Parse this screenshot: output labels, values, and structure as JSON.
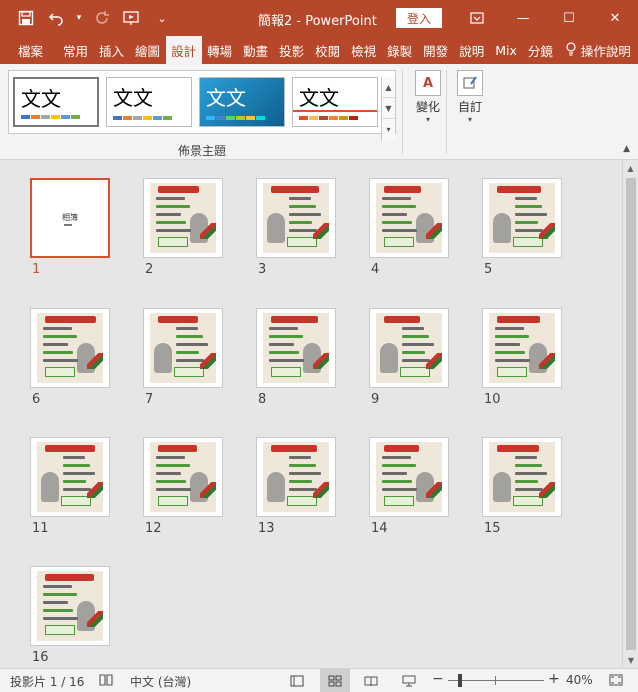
{
  "title_bar": {
    "doc_title": "簡報2 - PowerPoint",
    "sign_in": "登入",
    "qat": [
      {
        "name": "save-icon",
        "glyph": "💾"
      },
      {
        "name": "undo-icon",
        "glyph": "↶"
      },
      {
        "name": "undo-dropdown-icon",
        "glyph": "▾"
      },
      {
        "name": "redo-icon",
        "glyph": "↻"
      },
      {
        "name": "present-from-start-icon",
        "glyph": "▣"
      },
      {
        "name": "customize-qat-icon",
        "glyph": "⌄"
      }
    ],
    "window_buttons": {
      "ribbon_options": "▭",
      "minimize": "—",
      "restore": "☐",
      "close": "✕"
    }
  },
  "tabs": [
    {
      "label": "檔案",
      "active": false
    },
    {
      "label": "常用",
      "active": false
    },
    {
      "label": "插入",
      "active": false
    },
    {
      "label": "繪圖",
      "active": false
    },
    {
      "label": "設計",
      "active": true
    },
    {
      "label": "轉場",
      "active": false
    },
    {
      "label": "動畫",
      "active": false
    },
    {
      "label": "投影",
      "active": false
    },
    {
      "label": "校閱",
      "active": false
    },
    {
      "label": "檢視",
      "active": false
    },
    {
      "label": "錄製",
      "active": false
    },
    {
      "label": "開發",
      "active": false
    },
    {
      "label": "說明",
      "active": false
    },
    {
      "label": "Mix",
      "active": false
    },
    {
      "label": "分鏡",
      "active": false
    }
  ],
  "tell_me": {
    "label": "操作說明",
    "icon": "lightbulb-icon"
  },
  "ribbon": {
    "themes": [
      {
        "text": "文文",
        "bg": "#ffffff",
        "color": "#222222",
        "swatches": [
          "#4472c4",
          "#ed7d31",
          "#a5a5a5",
          "#ffc000",
          "#5b9bd5",
          "#70ad47"
        ]
      },
      {
        "text": "文文",
        "bg": "#ffffff",
        "color": "#222222",
        "swatches": [
          "#4472c4",
          "#ed7d31",
          "#a5a5a5",
          "#ffc000",
          "#5b9bd5",
          "#70ad47"
        ]
      },
      {
        "text": "文文",
        "bg": "#1e7fb5",
        "color": "#ffffff",
        "swatches": [
          "#31b6fd",
          "#4584d3",
          "#5bd078",
          "#a5d028",
          "#f5c040",
          "#05e0db"
        ]
      },
      {
        "text": "文文",
        "bg": "#ffffff",
        "color": "#222222",
        "swatches": [
          "#e84c22",
          "#ffbd47",
          "#b64926",
          "#ff8427",
          "#cc9900",
          "#b22600"
        ]
      }
    ],
    "group_label": "佈景主題",
    "variants_label": "變化",
    "customize_label": "自訂"
  },
  "slides": [
    {
      "num": "1",
      "title_text": "相簿"
    },
    {
      "num": "2"
    },
    {
      "num": "3"
    },
    {
      "num": "4"
    },
    {
      "num": "5"
    },
    {
      "num": "6"
    },
    {
      "num": "7"
    },
    {
      "num": "8"
    },
    {
      "num": "9"
    },
    {
      "num": "10"
    },
    {
      "num": "11"
    },
    {
      "num": "12"
    },
    {
      "num": "13"
    },
    {
      "num": "14"
    },
    {
      "num": "15"
    },
    {
      "num": "16"
    }
  ],
  "selected_slide": 1,
  "status_bar": {
    "slide_info": "投影片 1 / 16",
    "language": "中文 (台灣)",
    "zoom": "40%"
  },
  "colors": {
    "accent": "#b7472a",
    "selection": "#d35230"
  }
}
